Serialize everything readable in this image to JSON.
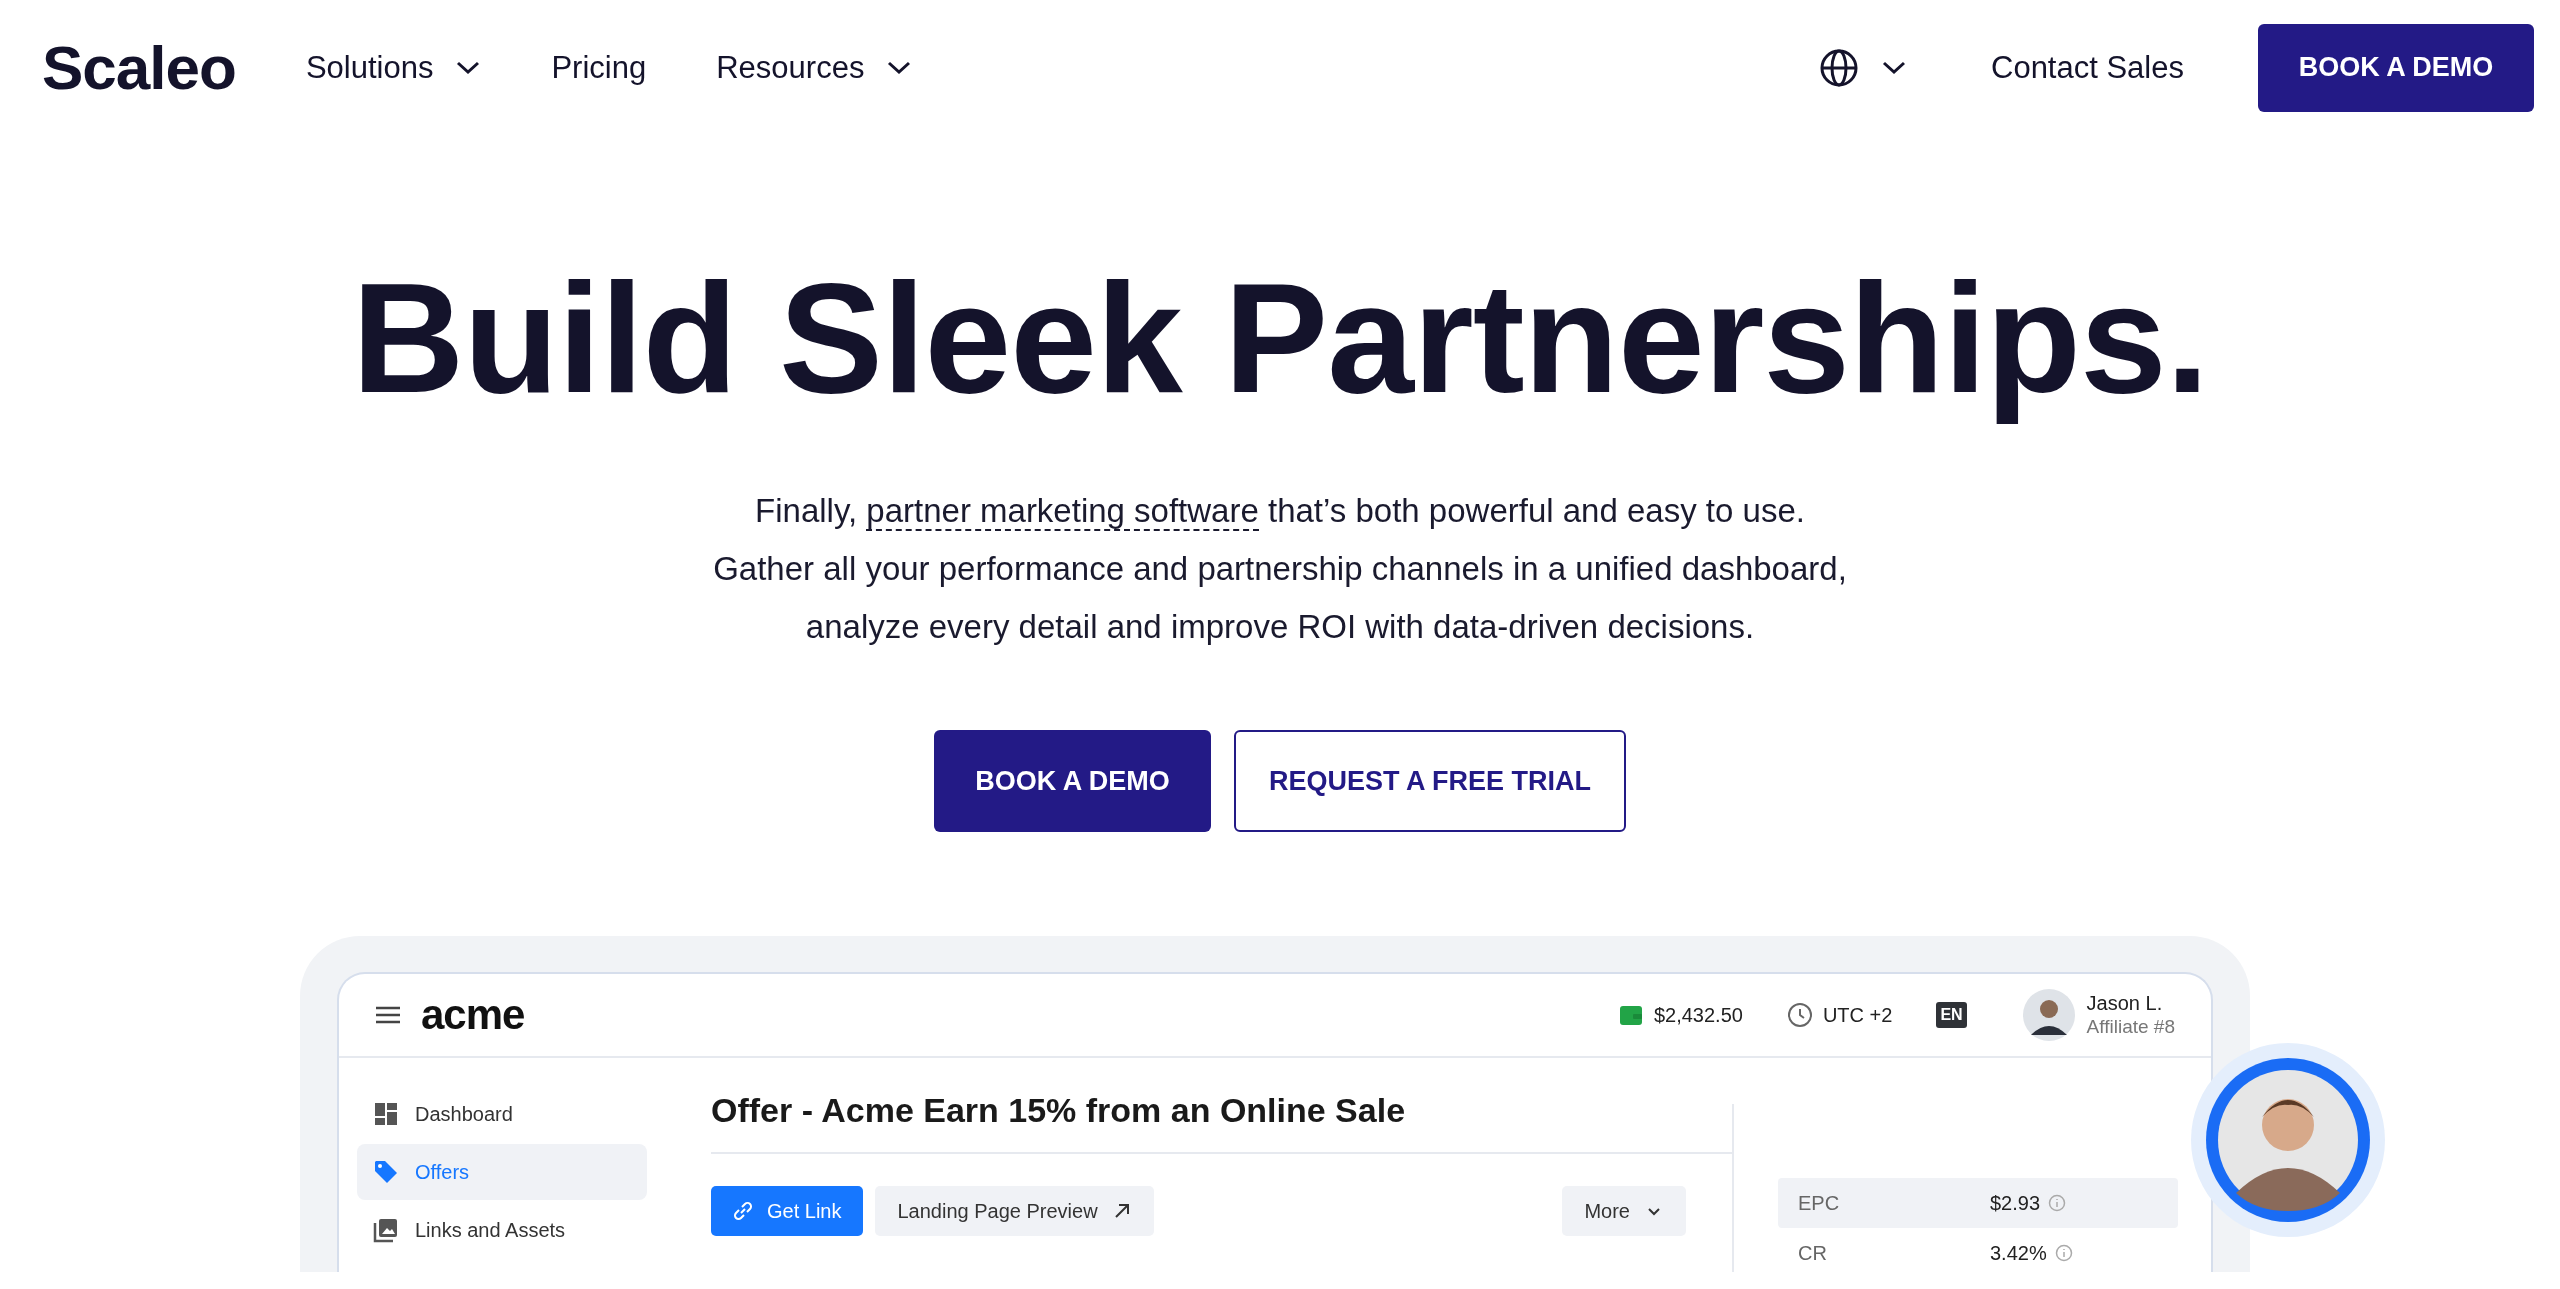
{
  "nav": {
    "logo": "Scaleo",
    "items": [
      {
        "label": "Solutions",
        "dropdown": true
      },
      {
        "label": "Pricing",
        "dropdown": false
      },
      {
        "label": "Resources",
        "dropdown": true
      }
    ],
    "language_menu": {
      "dropdown": true
    },
    "contact": "Contact Sales",
    "cta": "BOOK A DEMO"
  },
  "hero": {
    "headline": "Build Sleek Partnerships.",
    "intro": {
      "before": "Finally, ",
      "link": "partner marketing software",
      "after": " that’s both powerful and easy to use."
    },
    "lines": [
      "Gather all your performance and partnership channels in a unified dashboard,",
      "analyze every detail and improve ROI with data-driven decisions."
    ],
    "buttons": [
      {
        "label": "BOOK A DEMO",
        "kind": "primary"
      },
      {
        "label": "REQUEST A FREE TRIAL",
        "kind": "outline"
      }
    ]
  },
  "dashboard": {
    "logo": "acme",
    "balance": "$2,432.50",
    "timezone": "UTC +2",
    "language": "EN",
    "user": {
      "name": "Jason L.",
      "role": "Affiliate #8"
    },
    "sidebar": [
      {
        "label": "Dashboard",
        "selected": false
      },
      {
        "label": "Offers",
        "selected": true
      },
      {
        "label": "Links and Assets",
        "selected": false
      }
    ],
    "title": "Offer - Acme Earn 15% from an Online Sale",
    "actions": [
      {
        "label": "Get Link",
        "kind": "primary"
      },
      {
        "label": "Landing Page Preview",
        "kind": "secondary"
      }
    ],
    "more": "More",
    "stats": [
      {
        "label": "EPC",
        "value": "$2.93",
        "selected": true
      },
      {
        "label": "CR",
        "value": "3.42%",
        "selected": false
      }
    ]
  }
}
